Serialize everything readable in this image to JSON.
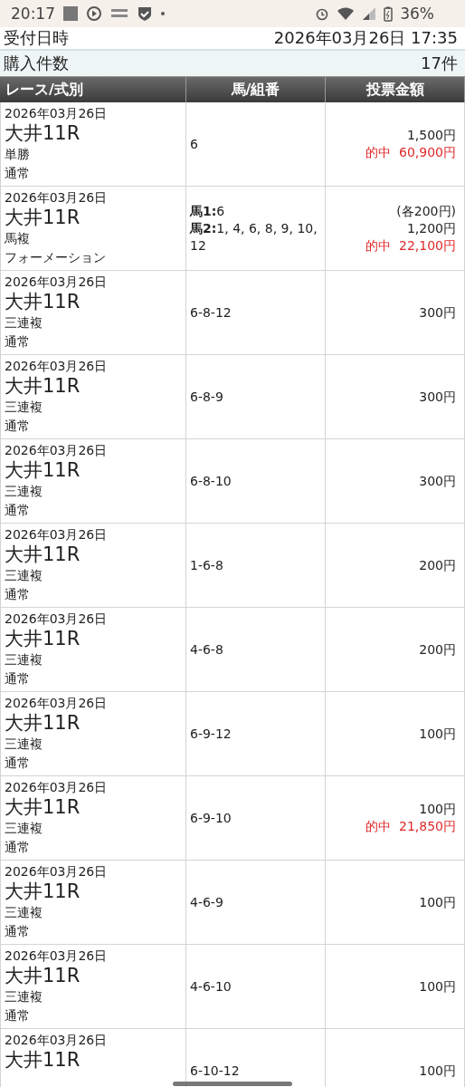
{
  "status_bar": {
    "time": "20:17",
    "battery": "36%"
  },
  "receipt": {
    "label": "受付日時",
    "value": "2026年03月26日 17:35"
  },
  "count": {
    "label": "購入件数",
    "value": "17件"
  },
  "table": {
    "columns": [
      "レース/式別",
      "馬/組番",
      "投票金額"
    ],
    "rows": [
      {
        "date": "2026年03月26日",
        "race": "大井11R",
        "bet_type": "単勝",
        "method": "通常",
        "combo": [
          "6"
        ],
        "amounts": [
          {
            "kind": "stake",
            "text": "1,500円"
          },
          {
            "kind": "hit",
            "text": "的中  60,900円"
          }
        ]
      },
      {
        "date": "2026年03月26日",
        "race": "大井11R",
        "bet_type": "馬複",
        "method": "フォーメーション",
        "combo": [
          "**馬1:**6",
          "**馬2:**1, 4, 6, 8, 9, 10, 12"
        ],
        "amounts": [
          {
            "kind": "stake",
            "text": "(各200円)"
          },
          {
            "kind": "stake",
            "text": "1,200円"
          },
          {
            "kind": "hit",
            "text": "的中  22,100円"
          }
        ]
      },
      {
        "date": "2026年03月26日",
        "race": "大井11R",
        "bet_type": "三連複",
        "method": "通常",
        "combo": [
          "6-8-12"
        ],
        "amounts": [
          {
            "kind": "stake",
            "text": "300円"
          }
        ]
      },
      {
        "date": "2026年03月26日",
        "race": "大井11R",
        "bet_type": "三連複",
        "method": "通常",
        "combo": [
          "6-8-9"
        ],
        "amounts": [
          {
            "kind": "stake",
            "text": "300円"
          }
        ]
      },
      {
        "date": "2026年03月26日",
        "race": "大井11R",
        "bet_type": "三連複",
        "method": "通常",
        "combo": [
          "6-8-10"
        ],
        "amounts": [
          {
            "kind": "stake",
            "text": "300円"
          }
        ]
      },
      {
        "date": "2026年03月26日",
        "race": "大井11R",
        "bet_type": "三連複",
        "method": "通常",
        "combo": [
          "1-6-8"
        ],
        "amounts": [
          {
            "kind": "stake",
            "text": "200円"
          }
        ]
      },
      {
        "date": "2026年03月26日",
        "race": "大井11R",
        "bet_type": "三連複",
        "method": "通常",
        "combo": [
          "4-6-8"
        ],
        "amounts": [
          {
            "kind": "stake",
            "text": "200円"
          }
        ]
      },
      {
        "date": "2026年03月26日",
        "race": "大井11R",
        "bet_type": "三連複",
        "method": "通常",
        "combo": [
          "6-9-12"
        ],
        "amounts": [
          {
            "kind": "stake",
            "text": "100円"
          }
        ]
      },
      {
        "date": "2026年03月26日",
        "race": "大井11R",
        "bet_type": "三連複",
        "method": "通常",
        "combo": [
          "6-9-10"
        ],
        "amounts": [
          {
            "kind": "stake",
            "text": "100円"
          },
          {
            "kind": "hit",
            "text": "的中  21,850円"
          }
        ]
      },
      {
        "date": "2026年03月26日",
        "race": "大井11R",
        "bet_type": "三連複",
        "method": "通常",
        "combo": [
          "4-6-9"
        ],
        "amounts": [
          {
            "kind": "stake",
            "text": "100円"
          }
        ]
      },
      {
        "date": "2026年03月26日",
        "race": "大井11R",
        "bet_type": "三連複",
        "method": "通常",
        "combo": [
          "4-6-10"
        ],
        "amounts": [
          {
            "kind": "stake",
            "text": "100円"
          }
        ]
      },
      {
        "date": "2026年03月26日",
        "race": "大井11R",
        "combo": [
          "6-10-12"
        ],
        "amounts": [
          {
            "kind": "stake",
            "text": "100円"
          }
        ]
      }
    ]
  }
}
